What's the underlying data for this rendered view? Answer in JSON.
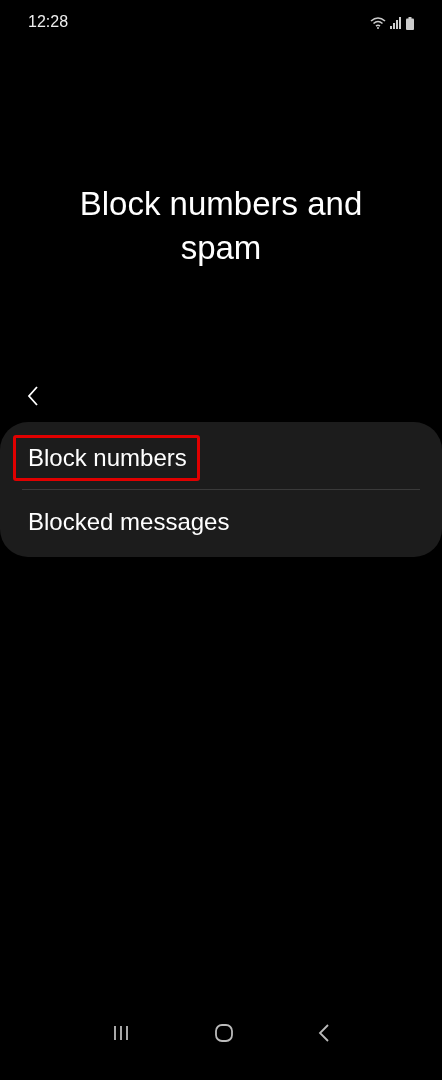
{
  "status_bar": {
    "time": "12:28"
  },
  "title": "Block numbers and spam",
  "items": [
    {
      "label": "Block numbers",
      "highlighted": true
    },
    {
      "label": "Blocked messages",
      "highlighted": false
    }
  ]
}
